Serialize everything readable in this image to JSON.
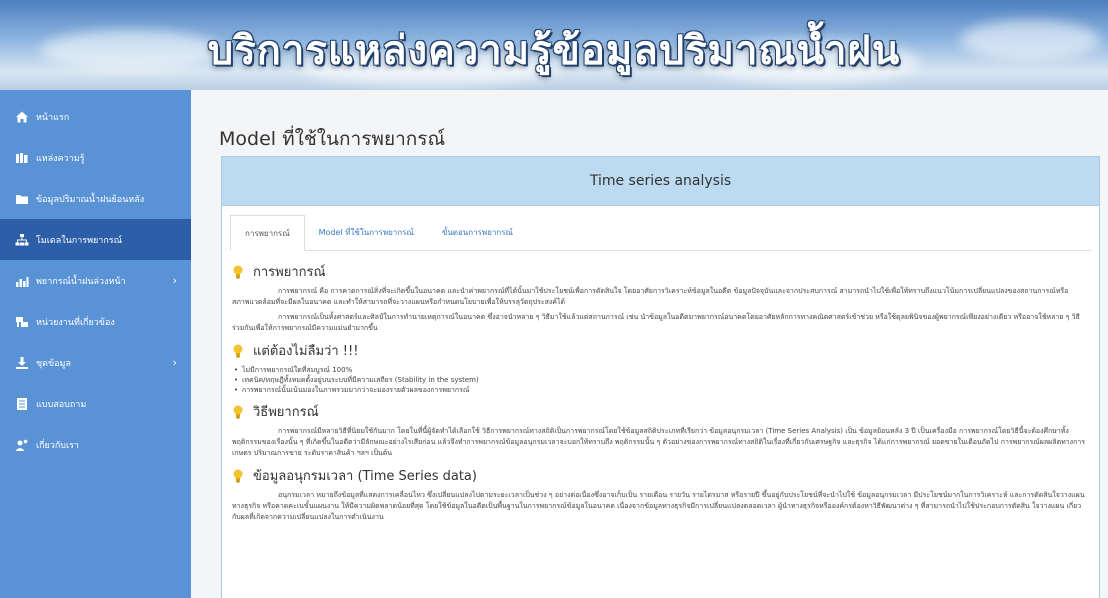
{
  "banner": {
    "title": "บริการแหล่งความรู้ข้อมูลปริมาณน้ำฝน"
  },
  "sidebar": {
    "items": [
      {
        "label": "หน้าแรก",
        "icon": "home-icon",
        "active": false,
        "has_children": false
      },
      {
        "label": "แหล่งความรู้",
        "icon": "books-icon",
        "active": false,
        "has_children": false
      },
      {
        "label": "ข้อมูลปริมาณน้ำฝนย้อนหลัง",
        "icon": "folder-icon",
        "active": false,
        "has_children": false
      },
      {
        "label": "โมเดลในการพยากรณ์",
        "icon": "sitemap-icon",
        "active": true,
        "has_children": false
      },
      {
        "label": "พยากรณ์น้ำฝนล่วงหน้า",
        "icon": "bar-chart-icon",
        "active": false,
        "has_children": true
      },
      {
        "label": "หน่วยงานที่เกี่ยวข้อง",
        "icon": "organization-icon",
        "active": false,
        "has_children": false
      },
      {
        "label": "ชุดข้อมูล",
        "icon": "download-icon",
        "active": false,
        "has_children": true
      },
      {
        "label": "แบบสอบถาม",
        "icon": "survey-icon",
        "active": false,
        "has_children": false
      },
      {
        "label": "เกี่ยวกับเรา",
        "icon": "users-icon",
        "active": false,
        "has_children": false
      }
    ],
    "chevron": "›"
  },
  "main": {
    "page_title": "Model ที่ใช้ในการพยากรณ์",
    "panel_heading": "Time series analysis",
    "tabs": [
      {
        "label": "การพยากรณ์",
        "active": true
      },
      {
        "label": "Model ที่ใช้ในการพยากรณ์",
        "active": false
      },
      {
        "label": "ขั้นตอนการพยากรณ์",
        "active": false
      }
    ],
    "sections": {
      "forecast": {
        "title": "การพยากรณ์",
        "para1": "การพยากรณ์ คือ การคาดการณ์สิ่งที่จะเกิดขึ้นในอนาคต และนำค่าพยากรณ์ที่ได้นั้นมาใช้ประโยชน์เพื่อการตัดสินใจ โดยอาศัยการวิเคราะห์ข้อมูลในอดีต ข้อมูลปัจจุบันและจากประสบการณ์ สามารถนำไปใช้เพื่อให้ทราบถึงแนวโน้มการเปลี่ยนแปลงของสถานการณ์หรือ สภาพแวดล้อมที่จะมีผลในอนาคต และทำให้สามารถที่จะวางแผนหรือกำหนดนโยบายเพื่อให้บรรลุวัตถุประสงค์ได้",
        "para2": "การพยากรณ์เป็นทั้งศาสตร์และศิลป์ในการทำนายเหตุการณ์ในอนาคต ซึ่งอาจนำหลาย ๆ วิธีมาใช้แล้วแต่สถานการณ์ เช่น นำข้อมูลในอดีตมาพยากรณ์อนาคตโดยอาศัยหลักการทางคณิตศาสตร์เข้าช่วย หรือใช้ดุลยพินิจของผู้พยากรณ์เพียงอย่างเดียว หรืออาจใช้หลาย ๆ วิธีร่วมกันเพื่อให้การพยากรณ์มีความแม่นยำมากขึ้น"
      },
      "remember": {
        "title": "แต่ต้องไม่ลืมว่า !!!",
        "bullets": [
          "ไม่มีการพยากรณ์ใดที่สมบูรณ์ 100%",
          "เทคนิค/ทฤษฎีทั้งหมดตั้งอยู่บนระบบที่มีความเสถียร (Stability in the system)",
          "การพยากรณ์นั้นเน้นมองในภาพรวมมากว่าจะมองรายตัวผลของการพยากรณ์"
        ]
      },
      "methods": {
        "title": "วิธีพยากรณ์",
        "para": "การพยากรณ์มีหลายวิธีที่นิยมใช้กันมาก โดยในที่นี้ผู้จัดทำได้เลือกใช้ วิธีการพยากรณ์ทางสถิติเป็นการพยากรณ์โดยใช้ข้อมูลสถิติประเภทที่เรียกว่า ข้อมูลอนุกรมเวลา (Time Series Analysis) เป็น ข้อมูลย้อนหลัง 3 ปี เป็นเครื่องมือ การพยากรณ์โดยวิธีนี้จะต้องศึกษาทั้งพฤติกรรมของเรื่องนั้น ๆ ที่เกิดขึ้นในอดีตว่ามีลักษณะอย่างไรเสียก่อน แล้วจึงทำการพยากรณ์ข้อมูลอนุกรมเวลาจะบอกให้ทราบถึง พฤติกรรมนั้น ๆ ตัวอย่างของการพยากรณ์ทางสถิติในเรื่องที่เกี่ยวกับเศรษฐกิจ และธุรกิจ ได้แก่การพยากรณ์ ยอดขายในเดือนถัดไป การพยากรณ์ผลผลิตทางการเกษตร ปริมาณการขาย ระดับราคาสินค้า ฯลฯ เป็นต้น"
      },
      "timeseries": {
        "title": "ข้อมูลอนุกรมเวลา (Time Series data)",
        "para": "อนุกรมเวลา หมายถึงข้อมูลที่แสดงการเคลื่อนไหว ซึ่งเปลี่ยนแปลงไปตามระยะเวลาเป็นช่วง ๆ อย่างต่อเนื่องซึ่งอาจเก็บเป็น รายเดือน รายวัน รายไตรมาส หรือรายปี ขึ้นอยู่กับประโยชน์ที่จะนำไปใช้ ข้อมูลอนุกรมเวลา มีประโยชน์มากในการวิเคราะห์ และการตัดสินใจวางแผนทางธุรกิจ หรือคาดคะเนขั้นแผนงาน ให้มีความผิดพลาดน้อยที่สุด โดยใช้ข้อมูลในอดีตเป็นพื้นฐานในการพยากรณ์ข้อมูลในอนาคต เนื่องจากข้อมูลทางธุรกิจมีการเปลี่ยนแปลงตลอดเวลา ผู้นำทางธุรกิจหรือองค์กรต้องหาวิธีพัฒนาต่าง ๆ ที่สามารถนำไปใช้ประกอบการตัดสิน ใจวางแผน เกี่ยวกับผลที่เกิดจากความเปลี่ยนแปลงในการดำเนินงาน"
      }
    }
  },
  "colors": {
    "sidebar_bg": "#5a92d6",
    "sidebar_active": "#2d5fa8",
    "panel_head": "#bcdaf0",
    "link": "#3a78c4",
    "bulb": "#f4c430"
  }
}
